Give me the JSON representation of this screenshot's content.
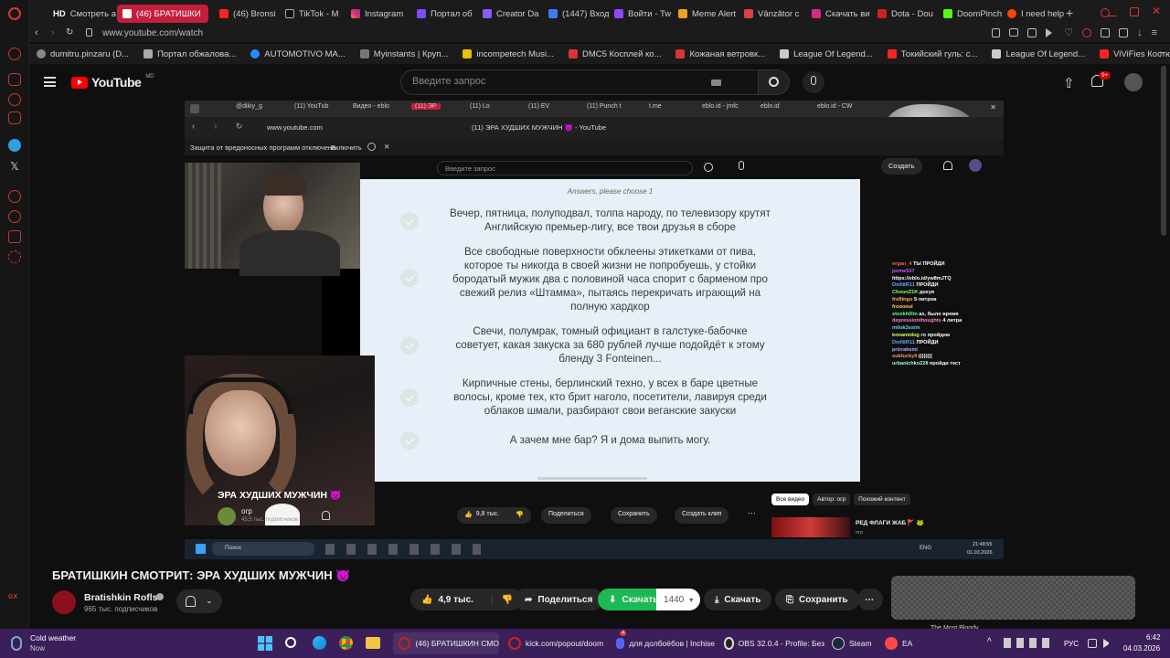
{
  "browser": {
    "tabs": [
      {
        "label": "Смотреть а",
        "badge": "HD"
      },
      {
        "label": "(46) БРАТИШКИ",
        "active": true
      },
      {
        "label": "(46) Bronsi"
      },
      {
        "label": "TikTok - M"
      },
      {
        "label": "Instagram"
      },
      {
        "label": "Портал об"
      },
      {
        "label": "Creator Da"
      },
      {
        "label": "(1447) Вход"
      },
      {
        "label": "Войти - Tw"
      },
      {
        "label": "Meme Alert"
      },
      {
        "label": "Vânzător c"
      },
      {
        "label": "Скачать ви"
      },
      {
        "label": "Dota - Dou"
      },
      {
        "label": "DoomPinch"
      },
      {
        "label": "I need help"
      }
    ],
    "url": "www.youtube.com/watch",
    "bookmarks": [
      "dumitru.pinzaru (D...",
      "Портал обжалова...",
      "AUTOMOTIVO MA...",
      "Myinstants | Круп...",
      "incompetech Musi...",
      "DMC5 Косплей ко...",
      "Кожаная ветровк...",
      "League Of Legend...",
      "Токийский гуль: с...",
      "League Of Legend...",
      "ViViFies Костюм..."
    ]
  },
  "youtube": {
    "logo_text": "YouTube",
    "logo_region": "MD",
    "search_placeholder": "Введите запрос",
    "notif_badge": "9+"
  },
  "stream": {
    "inner_tabs": [
      "@dikiy_g",
      "(11) YouTub",
      "Видео - eblo",
      "(11) ЭР",
      "(11) Lo",
      "(11) EV",
      "(11) Punch t",
      "t.me",
      "eblo.id - jmfc",
      "eblo.id",
      "eblo.id - CW"
    ],
    "inner_url": "www.youtube.com",
    "inner_page_title": "(11) ЭРА ХУДШИХ МУЖЧИН 👿 - YouTube",
    "notice_text": "Защита от вредоносных программ отключена",
    "notice_action": "Включить",
    "inner_search_placeholder": "Введите запрос",
    "create_label": "Создать",
    "quiz_header": "Answers, please choose 1",
    "quiz_options": [
      "Вечер, пятница, полуподвал, толпа народу, по телевизору крутят\nАнглийскую премьер-лигу, все твои друзья в сборе",
      "Все свободные поверхности обклеены этикетками от пива,\nкоторое ты никогда в своей жизни не попробуешь, у стойки\nбородатый мужик два с половиной часа спорит с барменом про\nсвежий релиз «Штамма», пытаясь перекричать играющий на\nполную хардкор",
      "Свечи, полумрак, томный официант в галстуке-бабочке\nсоветует, какая закуска за 680 рублей лучше подойдёт к этому\nбленду 3 Fonteinen...",
      "Кирпичные стены, берлинский техно, у всех в баре цветные\nволосы, кроме тех, кто брит наголо, посетители, лавируя среди\nоблаков шмали, разбирают свои веганские закуски",
      "А зачем мне бар? Я и дома выпить могу."
    ],
    "chat": [
      {
        "user": "ergan_4",
        "msg": "ТЫ ПРОЙДИ",
        "color": "#ff5c5c"
      },
      {
        "user": "jorme537",
        "msg": "",
        "color": "#c85cff"
      },
      {
        "user": "",
        "msg": "https://eblo.id/yw8mJTQ",
        "color": "#ffffff"
      },
      {
        "user": "DmNtR11",
        "msg": "ПРОЙДИ",
        "color": "#5ca8ff"
      },
      {
        "user": "ChoonZ1K",
        "msg": "дохуя",
        "color": "#7fff7f"
      },
      {
        "user": "frsflingo",
        "msg": "5 литров",
        "color": "#ffb35c"
      },
      {
        "user": "frooooui",
        "msg": "",
        "color": "#ffd75c"
      },
      {
        "user": "stoxkh0lm",
        "msg": "ах, было время",
        "color": "#5cff9a"
      },
      {
        "user": "depressionthoughts",
        "msg": "4 литра",
        "color": "#ff7fd1"
      },
      {
        "user": "m0ok3ssim",
        "msg": "",
        "color": "#5cd6ff"
      },
      {
        "user": "konamidog",
        "msg": "го пройдем",
        "color": "#d6ff5c"
      },
      {
        "user": "DmNtR11",
        "msg": "ПРОЙДИ",
        "color": "#5ca8ff"
      },
      {
        "user": "prizrakemi",
        "msg": "",
        "color": "#b0b0ff"
      },
      {
        "user": "sublucky0",
        "msg": "((((((((",
        "color": "#ff9a5c"
      },
      {
        "user": "urbanichko228",
        "msg": "пройди тест",
        "color": "#9affd6"
      }
    ],
    "inner_video_title": "ЭРА ХУДШИХ МУЖЧИН 👿",
    "inner_channel": "огр",
    "inner_subs": "45,5 тыс. подписчиков",
    "inner_likes": "9,8 тыс.",
    "inner_share": "Поделиться",
    "inner_save": "Сохранить",
    "inner_clip": "Создать клип",
    "inner_chips": [
      "Все видео",
      "Автор: огр",
      "Похожий контент"
    ],
    "inner_rec_title": "РЕД ФЛАГИ ЖАБ 🚩 🐸",
    "inner_rec_channel": "огр",
    "inner_taskbar_search": "Поиск",
    "inner_lang": "ENG",
    "inner_time": "21:48:55",
    "inner_date": "01.03.2026"
  },
  "video": {
    "title": "БРАТИШКИН СМОТРИТ: ЭРА ХУДШИХ МУЖЧИН 👿",
    "channel": "Bratishkin Rofls",
    "subscribers": "965 тыс. подписчиков",
    "likes": "4,9 тыс.",
    "share_label": "Поделиться",
    "download_label": "Скачать",
    "quality": "1440",
    "download2_label": "Скачать",
    "save_label": "Сохранить",
    "side_label": "The Most Bloody..."
  },
  "taskbar": {
    "weather_title": "Cold weather",
    "weather_sub": "Now",
    "apps": [
      {
        "label": "(46) БРАТИШКИН СМО"
      },
      {
        "label": "kick.com/popout/doom"
      },
      {
        "label": "для долбоёбов | Inchise"
      },
      {
        "label": "OBS 32.0.4 - Profile: Без"
      },
      {
        "label": "Steam"
      },
      {
        "label": "EA"
      }
    ],
    "discord_badge": "4",
    "lang": "РУС",
    "time": "6:42",
    "date": "04.03.2026"
  },
  "colors": {
    "accent_red": "#c41e3a",
    "yt_red": "#ff0000",
    "download_green": "#1db954",
    "taskbar_purple": "#3b1f5a"
  }
}
